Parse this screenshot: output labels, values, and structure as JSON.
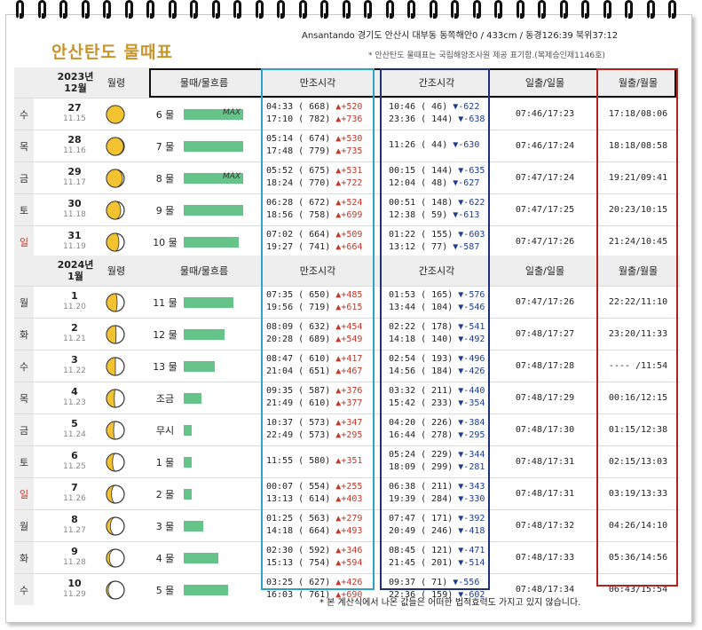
{
  "title": "안산탄도 물때표",
  "header_line1": "Ansantando 경기도 안산시 대부동 동쪽해안0 / 433cm / 동경126:39 북위37:12",
  "header_line2": "* 안산탄도 물때표는 국립해양조사원 제공 표기함.(복제승인제1146호)",
  "columns": {
    "moon": "월령",
    "mul": "물때/물흐름",
    "high": "만조시각",
    "low": "간조시각",
    "sun": "일출/일몰",
    "moonrs": "월출/월몰"
  },
  "sections": [
    {
      "year": "2023년",
      "month": "12월",
      "rows": [
        {
          "weekday": "수",
          "day": "27",
          "lunar": "11.15",
          "moon": 0.5,
          "mul": "6 물",
          "bar": 0.95,
          "max": "MAX",
          "high": [
            {
              "t": "04:33",
              "h": "( 668)",
              "d": "▲+520"
            },
            {
              "t": "17:10",
              "h": "( 782)",
              "d": "▲+736"
            }
          ],
          "low": [
            {
              "t": "10:46",
              "h": "(  46)",
              "d": "▼-622"
            },
            {
              "t": "23:36",
              "h": "( 144)",
              "d": "▼-638"
            }
          ],
          "sun": "07:46/17:23",
          "moonrs": "17:18/08:06"
        },
        {
          "weekday": "목",
          "day": "28",
          "lunar": "11.16",
          "moon": 0.52,
          "mul": "7 물",
          "bar": 0.95,
          "max": "",
          "high": [
            {
              "t": "05:14",
              "h": "( 674)",
              "d": "▲+530"
            },
            {
              "t": "17:48",
              "h": "( 779)",
              "d": "▲+735"
            }
          ],
          "low": [
            {
              "t": "11:26",
              "h": "(  44)",
              "d": "▼-630"
            }
          ],
          "sun": "07:46/17:24",
          "moonrs": "18:18/08:58"
        },
        {
          "weekday": "금",
          "day": "29",
          "lunar": "11.17",
          "moon": 0.55,
          "mul": "8 물",
          "bar": 0.95,
          "max": "MAX",
          "high": [
            {
              "t": "05:52",
              "h": "( 675)",
              "d": "▲+531"
            },
            {
              "t": "18:24",
              "h": "( 770)",
              "d": "▲+722"
            }
          ],
          "low": [
            {
              "t": "00:15",
              "h": "( 144)",
              "d": "▼-635"
            },
            {
              "t": "12:04",
              "h": "(  48)",
              "d": "▼-627"
            }
          ],
          "sun": "07:47/17:24",
          "moonrs": "19:21/09:41"
        },
        {
          "weekday": "토",
          "day": "30",
          "lunar": "11.18",
          "moon": 0.6,
          "mul": "9 물",
          "bar": 0.95,
          "max": "",
          "high": [
            {
              "t": "06:28",
              "h": "( 672)",
              "d": "▲+524"
            },
            {
              "t": "18:56",
              "h": "( 758)",
              "d": "▲+699"
            }
          ],
          "low": [
            {
              "t": "00:51",
              "h": "( 148)",
              "d": "▼-622"
            },
            {
              "t": "12:38",
              "h": "(  59)",
              "d": "▼-613"
            }
          ],
          "sun": "07:47/17:25",
          "moonrs": "20:23/10:15"
        },
        {
          "weekday": "일",
          "day": "31",
          "lunar": "11.19",
          "moon": 0.65,
          "mul": "10 물",
          "bar": 0.88,
          "max": "",
          "high": [
            {
              "t": "07:02",
              "h": "( 664)",
              "d": "▲+509"
            },
            {
              "t": "19:27",
              "h": "( 741)",
              "d": "▲+664"
            }
          ],
          "low": [
            {
              "t": "01:22",
              "h": "( 155)",
              "d": "▼-603"
            },
            {
              "t": "13:12",
              "h": "(  77)",
              "d": "▼-587"
            }
          ],
          "sun": "07:47/17:26",
          "moonrs": "21:24/10:45"
        }
      ]
    },
    {
      "year": "2024년",
      "month": "1월",
      "rows": [
        {
          "weekday": "월",
          "day": "1",
          "lunar": "11.20",
          "moon": 0.7,
          "mul": "11 물",
          "bar": 0.8,
          "max": "",
          "high": [
            {
              "t": "07:35",
              "h": "( 650)",
              "d": "▲+485"
            },
            {
              "t": "19:56",
              "h": "( 719)",
              "d": "▲+615"
            }
          ],
          "low": [
            {
              "t": "01:53",
              "h": "( 165)",
              "d": "▼-576"
            },
            {
              "t": "13:44",
              "h": "( 104)",
              "d": "▼-546"
            }
          ],
          "sun": "07:47/17:26",
          "moonrs": "22:22/11:10"
        },
        {
          "weekday": "화",
          "day": "2",
          "lunar": "11.21",
          "moon": 0.73,
          "mul": "12 물",
          "bar": 0.65,
          "max": "",
          "high": [
            {
              "t": "08:09",
              "h": "( 632)",
              "d": "▲+454"
            },
            {
              "t": "20:28",
              "h": "( 689)",
              "d": "▲+549"
            }
          ],
          "low": [
            {
              "t": "02:22",
              "h": "( 178)",
              "d": "▼-541"
            },
            {
              "t": "14:18",
              "h": "( 140)",
              "d": "▼-492"
            }
          ],
          "sun": "07:48/17:27",
          "moonrs": "23:20/11:33"
        },
        {
          "weekday": "수",
          "day": "3",
          "lunar": "11.22",
          "moon": 0.75,
          "mul": "13 물",
          "bar": 0.5,
          "max": "",
          "high": [
            {
              "t": "08:47",
              "h": "( 610)",
              "d": "▲+417"
            },
            {
              "t": "21:04",
              "h": "( 651)",
              "d": "▲+467"
            }
          ],
          "low": [
            {
              "t": "02:54",
              "h": "( 193)",
              "d": "▼-496"
            },
            {
              "t": "14:56",
              "h": "( 184)",
              "d": "▼-426"
            }
          ],
          "sun": "07:48/17:28",
          "moonrs": "---- /11:54"
        },
        {
          "weekday": "목",
          "day": "4",
          "lunar": "11.23",
          "moon": 0.78,
          "mul": "조금",
          "bar": 0.28,
          "max": "",
          "high": [
            {
              "t": "09:35",
              "h": "( 587)",
              "d": "▲+376"
            },
            {
              "t": "21:49",
              "h": "( 610)",
              "d": "▲+377"
            }
          ],
          "low": [
            {
              "t": "03:32",
              "h": "( 211)",
              "d": "▼-440"
            },
            {
              "t": "15:42",
              "h": "( 233)",
              "d": "▼-354"
            }
          ],
          "sun": "07:48/17:29",
          "moonrs": "00:16/12:15"
        },
        {
          "weekday": "금",
          "day": "5",
          "lunar": "11.24",
          "moon": 0.8,
          "mul": "무시",
          "bar": 0.13,
          "max": "",
          "high": [
            {
              "t": "10:37",
              "h": "( 573)",
              "d": "▲+347"
            },
            {
              "t": "22:49",
              "h": "( 573)",
              "d": "▲+295"
            }
          ],
          "low": [
            {
              "t": "04:20",
              "h": "( 226)",
              "d": "▼-384"
            },
            {
              "t": "16:44",
              "h": "( 278)",
              "d": "▼-295"
            }
          ],
          "sun": "07:48/17:30",
          "moonrs": "01:15/12:38"
        },
        {
          "weekday": "토",
          "day": "6",
          "lunar": "11.25",
          "moon": 0.83,
          "mul": "1 물",
          "bar": 0.13,
          "max": "",
          "high": [
            {
              "t": "11:55",
              "h": "( 580)",
              "d": "▲+351"
            }
          ],
          "low": [
            {
              "t": "05:24",
              "h": "( 229)",
              "d": "▼-344"
            },
            {
              "t": "18:09",
              "h": "( 299)",
              "d": "▼-281"
            }
          ],
          "sun": "07:48/17:31",
          "moonrs": "02:15/13:03"
        },
        {
          "weekday": "일",
          "day": "7",
          "lunar": "11.26",
          "moon": 0.86,
          "mul": "2 물",
          "bar": 0.13,
          "max": "",
          "high": [
            {
              "t": "00:07",
              "h": "( 554)",
              "d": "▲+255"
            },
            {
              "t": "13:13",
              "h": "( 614)",
              "d": "▲+403"
            }
          ],
          "low": [
            {
              "t": "06:38",
              "h": "( 211)",
              "d": "▼-343"
            },
            {
              "t": "19:39",
              "h": "( 284)",
              "d": "▼-330"
            }
          ],
          "sun": "07:48/17:31",
          "moonrs": "03:19/13:33"
        },
        {
          "weekday": "월",
          "day": "8",
          "lunar": "11.27",
          "moon": 0.89,
          "mul": "3 물",
          "bar": 0.32,
          "max": "",
          "high": [
            {
              "t": "01:25",
              "h": "( 563)",
              "d": "▲+279"
            },
            {
              "t": "14:18",
              "h": "( 664)",
              "d": "▲+493"
            }
          ],
          "low": [
            {
              "t": "07:47",
              "h": "( 171)",
              "d": "▼-392"
            },
            {
              "t": "20:49",
              "h": "( 246)",
              "d": "▼-418"
            }
          ],
          "sun": "07:48/17:32",
          "moonrs": "04:26/14:10"
        },
        {
          "weekday": "화",
          "day": "9",
          "lunar": "11.28",
          "moon": 0.92,
          "mul": "4 물",
          "bar": 0.55,
          "max": "",
          "high": [
            {
              "t": "02:30",
              "h": "( 592)",
              "d": "▲+346"
            },
            {
              "t": "15:13",
              "h": "( 754)",
              "d": "▲+594"
            }
          ],
          "low": [
            {
              "t": "08:45",
              "h": "( 121)",
              "d": "▼-471"
            },
            {
              "t": "21:45",
              "h": "( 201)",
              "d": "▼-514"
            }
          ],
          "sun": "07:48/17:33",
          "moonrs": "05:36/14:56"
        },
        {
          "weekday": "수",
          "day": "10",
          "lunar": "11.29",
          "moon": 0.95,
          "mul": "5 물",
          "bar": 0.72,
          "max": "",
          "high": [
            {
              "t": "03:25",
              "h": "( 627)",
              "d": "▲+426"
            },
            {
              "t": "16:03",
              "h": "( 761)",
              "d": "▲+690"
            }
          ],
          "low": [
            {
              "t": "09:37",
              "h": "(  71)",
              "d": "▼-556"
            },
            {
              "t": "22:36",
              "h": "( 159)",
              "d": "▼-602"
            }
          ],
          "sun": "07:48/17:34",
          "moonrs": "06:43/15:54"
        }
      ]
    }
  ],
  "footnote": "* 본 계산식에서 나온 값들은 어떠한 법적효력도 가지고 있지 않습니다.",
  "colors": {
    "title": "#c8942c",
    "bar": "#66c38a",
    "box_high": "#2ea3c9",
    "box_low": "#1f2f7a",
    "box_moonrs": "#b22222",
    "up": "#c0392b",
    "down": "#1f3b8f",
    "moon_fill": "#f2c230"
  }
}
